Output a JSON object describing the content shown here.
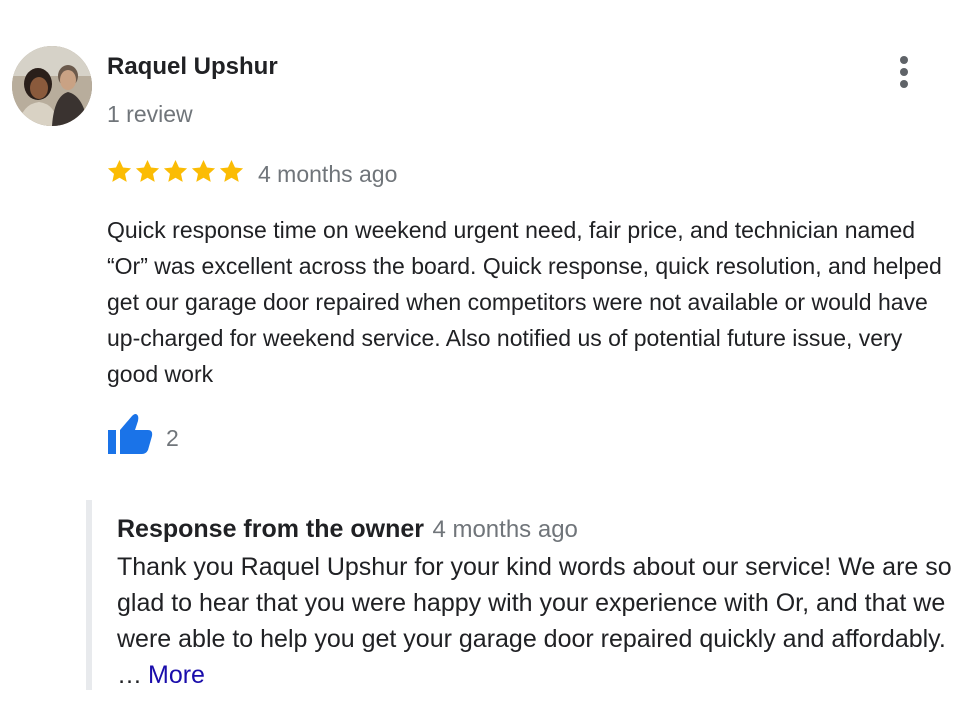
{
  "reviewer": {
    "name": "Raquel Upshur",
    "review_count": "1 review",
    "avatar_icon": "reviewer-avatar-photo"
  },
  "rating": {
    "stars": 5,
    "max_stars": 5,
    "star_color": "#fbbc04",
    "time": "4 months ago"
  },
  "review": {
    "text": "Quick response time on weekend urgent need, fair price, and technician named “Or” was excellent across the board. Quick response, quick resolution, and helped get our garage door repaired when competitors were not available or would have up-charged for weekend service. Also notified us of potential future issue, very good work"
  },
  "actions": {
    "like_icon": "thumbs-up-icon",
    "like_count": "2",
    "like_color": "#1a73e8",
    "menu_icon": "more-vert-icon"
  },
  "owner_response": {
    "title": "Response from the owner",
    "time": "4 months ago",
    "text": "Thank you Raquel Upshur for your kind words about our service! We are so glad to hear that you were happy with your experience with Or, and that we were able to help you get your garage door repaired quickly and affordably. …",
    "more_label": "More",
    "link_color": "#1a0dab"
  }
}
